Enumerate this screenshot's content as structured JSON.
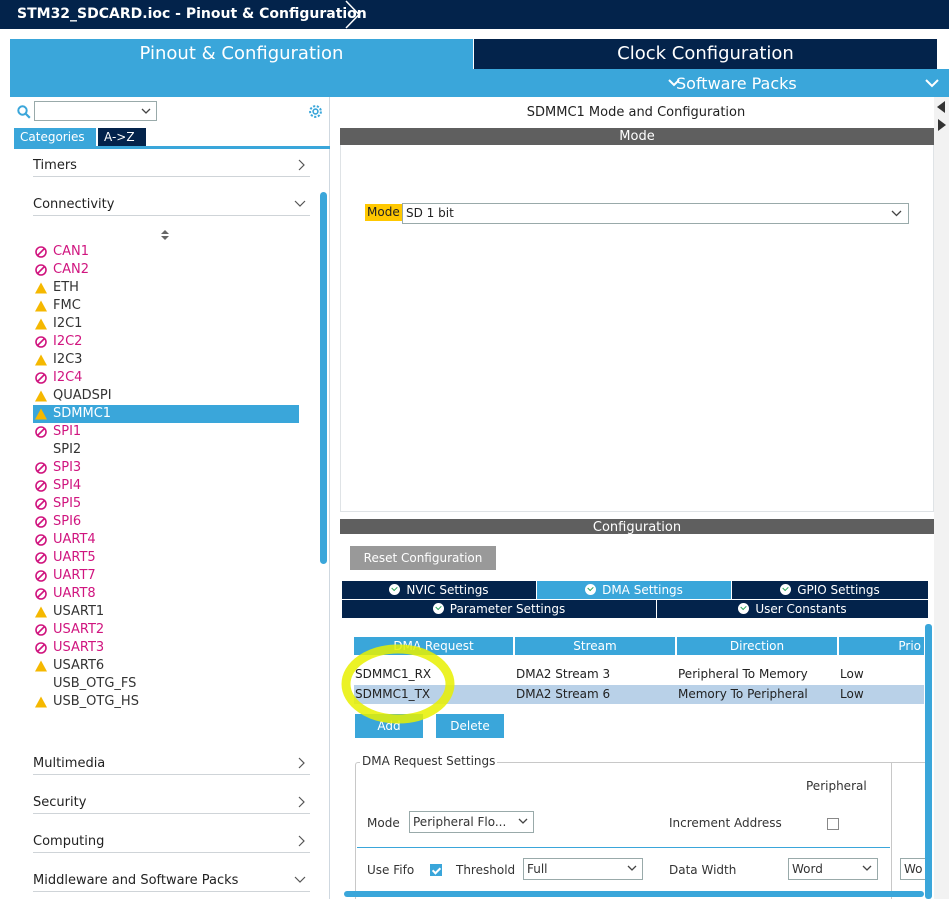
{
  "window": {
    "title": "STM32_SDCARD.ioc - Pinout & Configuration"
  },
  "main_tabs": [
    {
      "label": "Pinout & Configuration",
      "active": true
    },
    {
      "label": "Clock Configuration",
      "active": false
    }
  ],
  "software_packs": {
    "label": "Software Packs"
  },
  "left": {
    "search": {
      "value": ""
    },
    "category_tabs": [
      {
        "label": "Categories",
        "active": true
      },
      {
        "label": "A->Z",
        "active": false
      }
    ],
    "sections": {
      "timers": "Timers",
      "connectivity": "Connectivity",
      "multimedia": "Multimedia",
      "security": "Security",
      "computing": "Computing",
      "middleware": "Middleware and Software Packs"
    },
    "peripherals": [
      {
        "name": "CAN1",
        "status": "disabled"
      },
      {
        "name": "CAN2",
        "status": "disabled"
      },
      {
        "name": "ETH",
        "status": "warning"
      },
      {
        "name": "FMC",
        "status": "warning"
      },
      {
        "name": "I2C1",
        "status": "warning"
      },
      {
        "name": "I2C2",
        "status": "disabled"
      },
      {
        "name": "I2C3",
        "status": "warning"
      },
      {
        "name": "I2C4",
        "status": "disabled"
      },
      {
        "name": "QUADSPI",
        "status": "warning"
      },
      {
        "name": "SDMMC1",
        "status": "warning",
        "selected": true
      },
      {
        "name": "SPI1",
        "status": "disabled"
      },
      {
        "name": "SPI2",
        "status": "none"
      },
      {
        "name": "SPI3",
        "status": "disabled"
      },
      {
        "name": "SPI4",
        "status": "disabled"
      },
      {
        "name": "SPI5",
        "status": "disabled"
      },
      {
        "name": "SPI6",
        "status": "disabled"
      },
      {
        "name": "UART4",
        "status": "disabled"
      },
      {
        "name": "UART5",
        "status": "disabled"
      },
      {
        "name": "UART7",
        "status": "disabled"
      },
      {
        "name": "UART8",
        "status": "disabled"
      },
      {
        "name": "USART1",
        "status": "warning"
      },
      {
        "name": "USART2",
        "status": "disabled"
      },
      {
        "name": "USART3",
        "status": "disabled"
      },
      {
        "name": "USART6",
        "status": "warning"
      },
      {
        "name": "USB_OTG_FS",
        "status": "none"
      },
      {
        "name": "USB_OTG_HS",
        "status": "warning"
      }
    ]
  },
  "right": {
    "title": "SDMMC1 Mode and Configuration",
    "mode_header": "Mode",
    "mode": {
      "label": "Mode",
      "value": "SD 1 bit"
    },
    "config_header": "Configuration",
    "reset_button": "Reset Configuration",
    "subtabs_row1": [
      {
        "label": "NVIC Settings",
        "active": false
      },
      {
        "label": "DMA Settings",
        "active": true
      },
      {
        "label": "GPIO Settings",
        "active": false
      }
    ],
    "subtabs_row2": [
      {
        "label": "Parameter Settings"
      },
      {
        "label": "User Constants"
      }
    ],
    "dma_table": {
      "headers": [
        "DMA Request",
        "Stream",
        "Direction",
        "Prio"
      ],
      "rows": [
        {
          "request": "SDMMC1_RX",
          "stream": "DMA2 Stream 3",
          "direction": "Peripheral To Memory",
          "priority": "Low",
          "selected": false
        },
        {
          "request": "SDMMC1_TX",
          "stream": "DMA2 Stream 6",
          "direction": "Memory To Peripheral",
          "priority": "Low",
          "selected": true
        }
      ]
    },
    "add_button": "Add",
    "delete_button": "Delete",
    "dma_settings": {
      "legend": "DMA Request Settings",
      "peripheral_header": "Peripheral",
      "mode_label": "Mode",
      "mode_value": "Peripheral Flo...",
      "increment_label": "Increment Address",
      "use_fifo_label": "Use Fifo",
      "threshold_label": "Threshold",
      "threshold_value": "Full",
      "data_width_label": "Data Width",
      "data_width_value": "Word",
      "data_width_value2": "Wo"
    }
  },
  "colors": {
    "navy": "#03234b",
    "accent": "#3aa6da",
    "disabled": "#d0157f",
    "warning": "#f5b800",
    "annotation": "#e8f000"
  }
}
